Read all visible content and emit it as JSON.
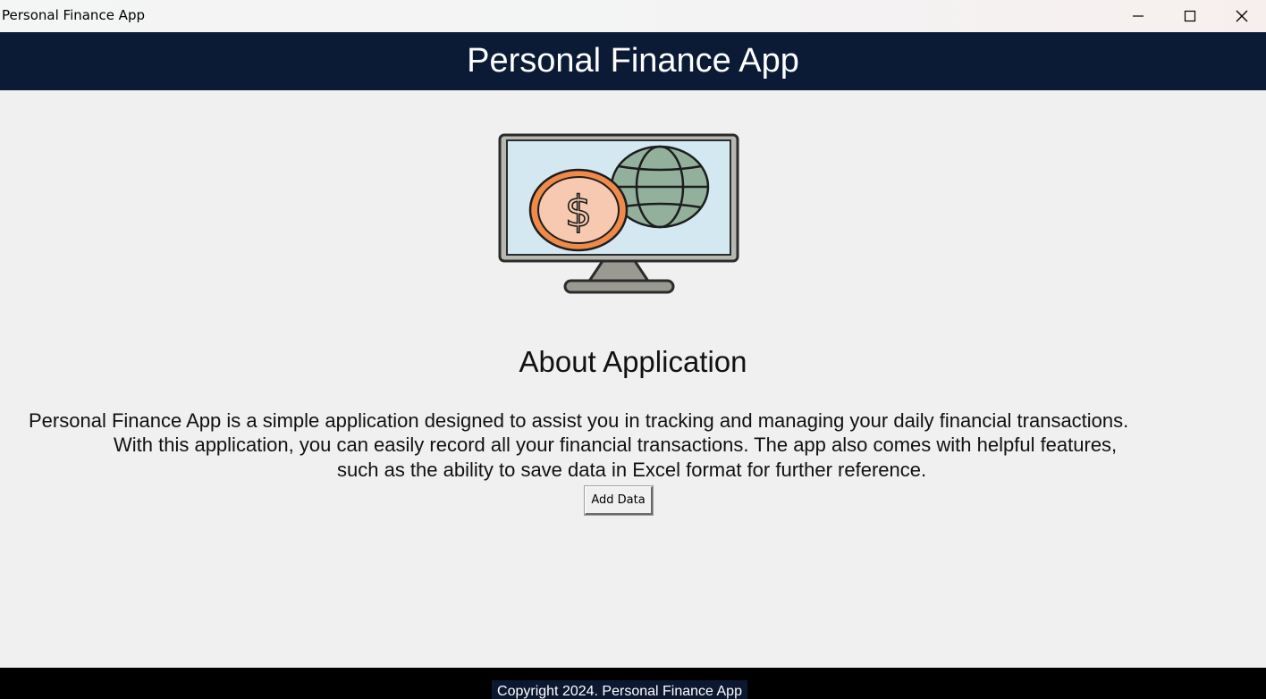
{
  "window": {
    "title": "Personal Finance App",
    "controls": [
      "minimize-icon",
      "maximize-icon",
      "close-icon"
    ]
  },
  "header": {
    "title": "Personal Finance App"
  },
  "hero": {
    "icon": "monitor-finance-icon"
  },
  "about": {
    "heading": "About Application",
    "lines": [
      "Personal Finance App is a simple application designed to assist you in tracking and managing your daily financial transactions.",
      "With this application, you can easily record all your financial transactions. The app also comes with helpful features,",
      "such as the ability to save data in Excel format for further reference."
    ]
  },
  "actions": {
    "add_data_label": "Add Data"
  },
  "footer": {
    "copyright": "Copyright 2024. Personal Finance App"
  },
  "colors": {
    "header_bg": "#0b1a35",
    "screen": "#d4e8f2",
    "coin": "#f6c9b0",
    "coin_rim": "#ef8a48",
    "globe": "#93b09c"
  }
}
